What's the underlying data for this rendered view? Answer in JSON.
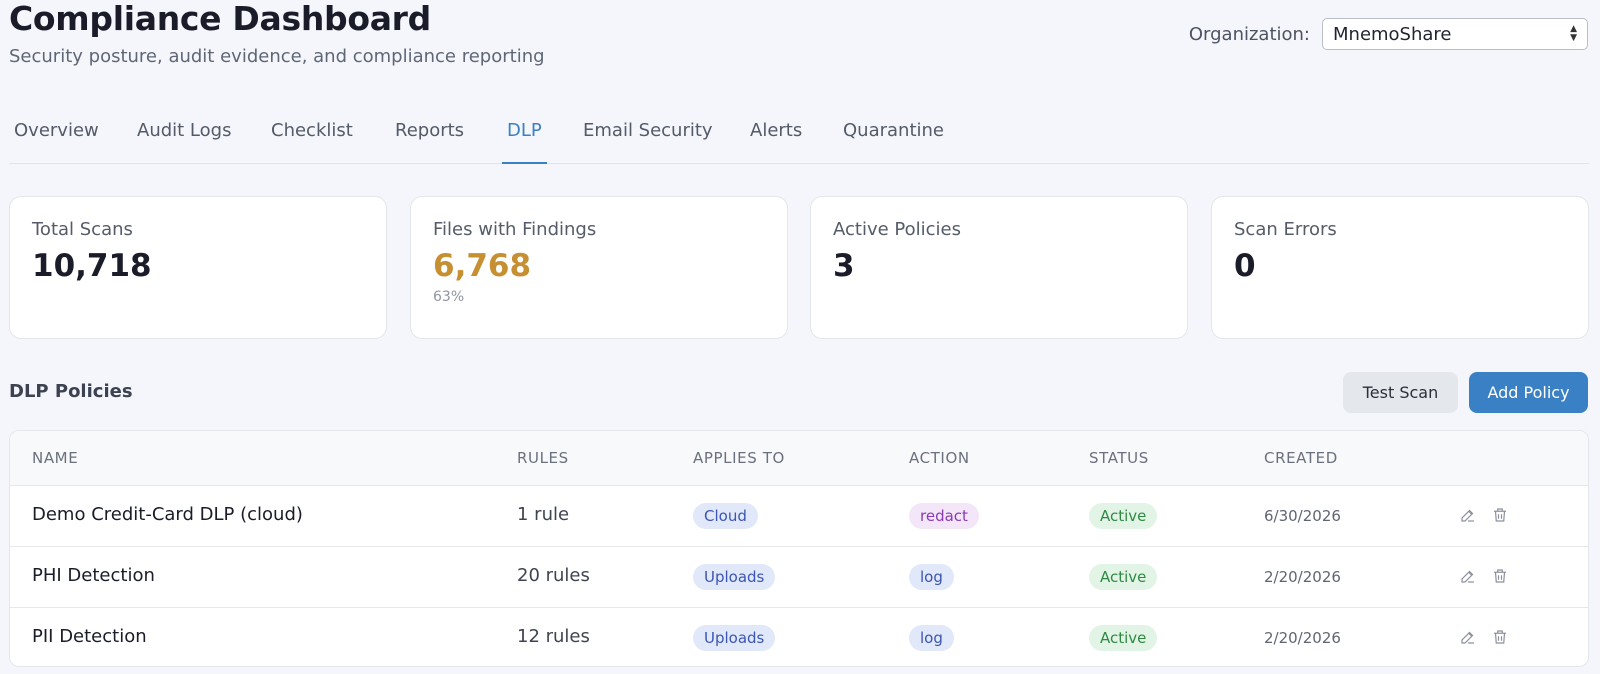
{
  "header": {
    "title": "Compliance Dashboard",
    "subtitle": "Security posture, audit evidence, and compliance reporting"
  },
  "organization": {
    "label": "Organization:",
    "selected": "MnemoShare"
  },
  "tabs": [
    {
      "label": "Overview",
      "active": false
    },
    {
      "label": "Audit Logs",
      "active": false
    },
    {
      "label": "Checklist",
      "active": false
    },
    {
      "label": "Reports",
      "active": false
    },
    {
      "label": "DLP",
      "active": true
    },
    {
      "label": "Email Security",
      "active": false
    },
    {
      "label": "Alerts",
      "active": false
    },
    {
      "label": "Quarantine",
      "active": false
    }
  ],
  "stats": [
    {
      "label": "Total Scans",
      "value": "10,718",
      "sub": ""
    },
    {
      "label": "Files with Findings",
      "value": "6,768",
      "sub": "63%"
    },
    {
      "label": "Active Policies",
      "value": "3",
      "sub": ""
    },
    {
      "label": "Scan Errors",
      "value": "0",
      "sub": ""
    }
  ],
  "policies": {
    "title": "DLP Policies",
    "test_scan_label": "Test Scan",
    "add_policy_label": "Add Policy",
    "columns": [
      "NAME",
      "RULES",
      "APPLIES TO",
      "ACTION",
      "STATUS",
      "CREATED"
    ],
    "rows": [
      {
        "name": "Demo Credit-Card DLP (cloud)",
        "rules": "1 rule",
        "applies_to": "Cloud",
        "action": "redact",
        "status": "Active",
        "created": "6/30/2026"
      },
      {
        "name": "PHI Detection",
        "rules": "20 rules",
        "applies_to": "Uploads",
        "action": "log",
        "status": "Active",
        "created": "2/20/2026"
      },
      {
        "name": "PII Detection",
        "rules": "12 rules",
        "applies_to": "Uploads",
        "action": "log",
        "status": "Active",
        "created": "2/20/2026"
      }
    ]
  },
  "colors": {
    "accent": "#3a80c5",
    "warning_value": "#c68f32",
    "status_active": "#2e8a43",
    "action_redact": "#8a3bb3"
  },
  "icons": {
    "edit": "edit-icon",
    "delete": "trash-icon",
    "select_arrows": "chevron-updown-icon"
  }
}
